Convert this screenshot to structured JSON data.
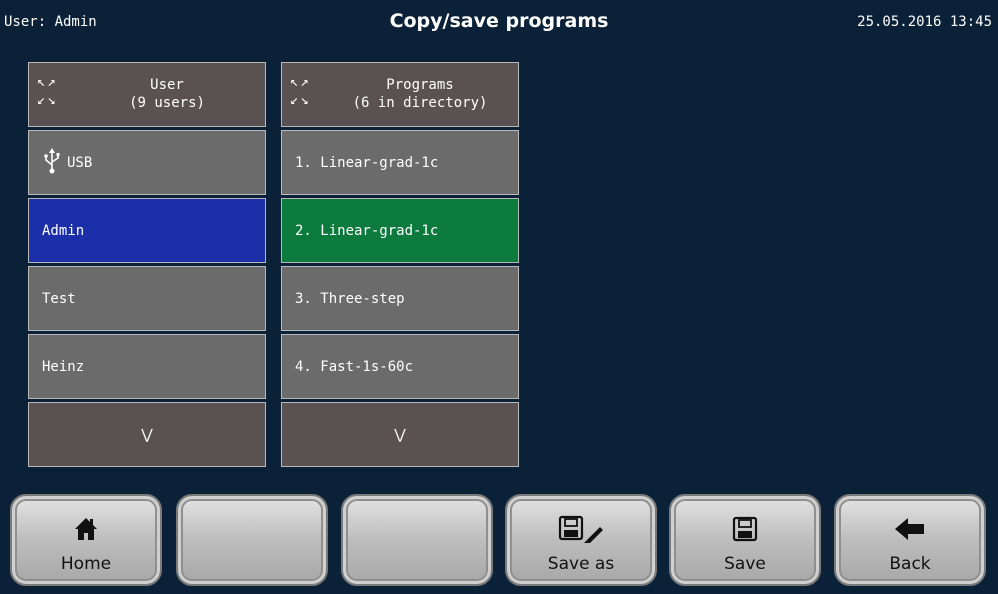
{
  "header": {
    "user": "User: Admin",
    "title": "Copy/save programs",
    "datetime": "25.05.2016 13:45"
  },
  "users": {
    "header": {
      "title": "User",
      "subtitle": "(9 users)"
    },
    "items": [
      {
        "label": "USB",
        "icon": "usb-icon"
      },
      {
        "label": "Admin",
        "selected": true
      },
      {
        "label": "Test"
      },
      {
        "label": "Heinz"
      }
    ],
    "more_icon": "chevron-double-down-icon"
  },
  "programs": {
    "header": {
      "title": "Programs",
      "subtitle": "(6 in directory)"
    },
    "items": [
      {
        "label": "1. Linear-grad-1c"
      },
      {
        "label": "2. Linear-grad-1c",
        "selected": true
      },
      {
        "label": "3. Three-step"
      },
      {
        "label": "4. Fast-1s-60c"
      }
    ],
    "more_icon": "chevron-double-down-icon"
  },
  "toolbar": {
    "home_label": "Home",
    "save_as_label": "Save as",
    "save_label": "Save",
    "back_label": "Back"
  },
  "colors": {
    "background": "#0b2138",
    "selected_user": "#1b30a8",
    "selected_program": "#0c7a3c",
    "cell": "#6b6b6b",
    "header_cell": "#5a5252"
  }
}
